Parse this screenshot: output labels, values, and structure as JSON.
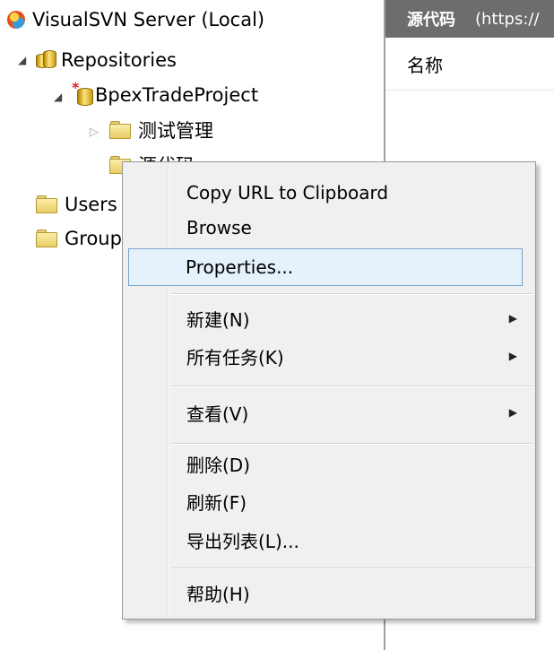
{
  "tree": {
    "root": {
      "label": "VisualSVN Server (Local)",
      "icon": "visualsvn-server-icon"
    },
    "repositories": {
      "label": "Repositories",
      "icon": "repositories-icon"
    },
    "project": {
      "label": "BpexTradeProject",
      "icon": "repository-icon"
    },
    "folder1": {
      "label": "测试管理",
      "icon": "folder-icon"
    },
    "folder2": {
      "label": "源代码",
      "icon": "folder-icon"
    },
    "users": {
      "label": "Users",
      "icon": "folder-icon"
    },
    "groups": {
      "label": "Groups",
      "icon": "folder-icon"
    }
  },
  "right_pane": {
    "title": "源代码",
    "url": "(https://",
    "column_header": "名称"
  },
  "context_menu": {
    "items": [
      {
        "label": "Copy URL to Clipboard"
      },
      {
        "label": "Browse"
      },
      {
        "label": "Properties...",
        "highlighted": true
      },
      {
        "label": "新建(N)",
        "submenu": true
      },
      {
        "label": "所有任务(K)",
        "submenu": true
      },
      {
        "label": "查看(V)",
        "submenu": true
      },
      {
        "label": "删除(D)"
      },
      {
        "label": "刷新(F)"
      },
      {
        "label": "导出列表(L)..."
      },
      {
        "label": "帮助(H)"
      }
    ],
    "submenu_arrow": "▶"
  },
  "colors": {
    "highlight_bg": "#e5f1fb",
    "highlight_border": "#7da2ce",
    "menu_bg": "#f0f0f0",
    "header_bg": "#6d6d6d"
  }
}
